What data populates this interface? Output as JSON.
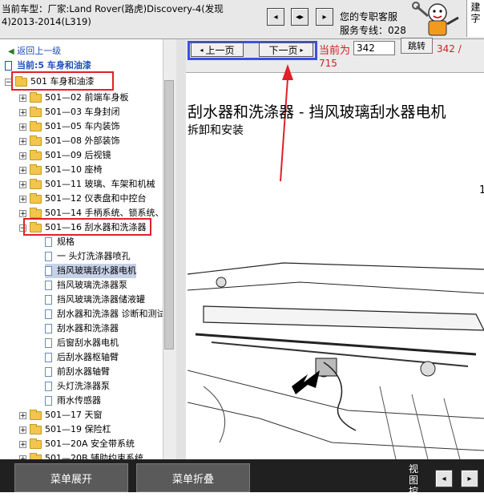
{
  "header": {
    "car_model": "当前车型：厂家:Land Rover(路虎)Discovery-4(发现4)2013-2014(L319)",
    "nav_prev_icon": "◂",
    "nav_both_icon": "◂▸",
    "nav_next_icon": "▸",
    "service_line1": "您的专职客服",
    "service_line2": "服务专线：028",
    "side_tab": "建字"
  },
  "tree": {
    "back_label": "返回上一级",
    "current_label": "当前:5  车身和油漆",
    "root": {
      "expander": "−",
      "label": "501 车身和油漆"
    },
    "groups_before": [
      {
        "expander": "+",
        "label": "501—02 前端车身板"
      },
      {
        "expander": "+",
        "label": "501—03 车身封闭"
      },
      {
        "expander": "+",
        "label": "501—05 车内装饰"
      },
      {
        "expander": "+",
        "label": "501—08 外部装饰"
      },
      {
        "expander": "+",
        "label": "501—09 后视镜"
      },
      {
        "expander": "+",
        "label": "501—10 座椅"
      },
      {
        "expander": "+",
        "label": "501—11 玻璃、车架和机械"
      },
      {
        "expander": "+",
        "label": "501—12 仪表盘和中控台"
      },
      {
        "expander": "+",
        "label": "501—14 手柄系统、锁系统、"
      }
    ],
    "open_group": {
      "expander": "−",
      "label": "501—16 刮水器和洗涤器"
    },
    "docs": [
      {
        "label": "规格"
      },
      {
        "label": "一 头灯洗涤器喷孔"
      },
      {
        "label": "挡风玻璃刮水器电机"
      },
      {
        "label": "挡风玻璃洗涤器泵"
      },
      {
        "label": "挡风玻璃洗涤器储液罐"
      },
      {
        "label": "刮水器和洗涤器 诊断和测试"
      },
      {
        "label": "刮水器和洗涤器"
      },
      {
        "label": "后窗刮水器电机"
      },
      {
        "label": "后刮水器枢轴臂"
      },
      {
        "label": "前刮水器轴臂"
      },
      {
        "label": "头灯洗涤器泵"
      },
      {
        "label": "雨水传感器"
      }
    ],
    "groups_after": [
      {
        "expander": "+",
        "label": "501—17 天窗"
      },
      {
        "expander": "+",
        "label": "501—19 保险杠"
      },
      {
        "expander": "+",
        "label": "501—20A 安全带系统"
      },
      {
        "expander": "+",
        "label": "501—20B 辅助约束系统"
      }
    ]
  },
  "pager": {
    "prev_label": "上一页",
    "next_label": "下一页",
    "current_label": "当前为",
    "page_value": "342",
    "jump_label": "跳转",
    "total_a": "342 /",
    "total_b": "715"
  },
  "document": {
    "title": "刮水器和洗涤器 - 挡风玻璃刮水器电机",
    "subtitle": "拆卸和安装",
    "margin_letter": "1"
  },
  "bottom": {
    "expand_label": "菜单展开",
    "collapse_label": "菜单折叠",
    "view_label": "视图控"
  },
  "colors": {
    "highlight": "#e0202a",
    "nav_frame": "#3f4fe0",
    "selected_row": "#c7d2e8"
  }
}
